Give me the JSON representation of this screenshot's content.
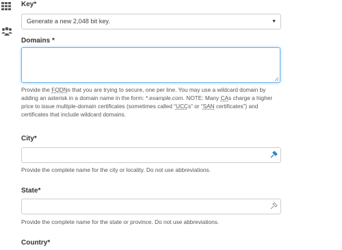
{
  "sidebar": {
    "icons": [
      "grid-icon",
      "users-icon"
    ],
    "accent": "#444444"
  },
  "form": {
    "key": {
      "label": "Key*",
      "selected": "Generate a new 2,048 bit key."
    },
    "domains": {
      "label": "Domains *",
      "value": "",
      "help": {
        "p1": "Provide the ",
        "abbr_fqdn": "FQDN",
        "p2": "s that you are trying to secure, one per line. You may use a wildcard domain by adding an asterisk in a domain name in the form: ",
        "example": "*.example.com",
        "p3": ". NOTE: Many ",
        "abbr_ca": "CA",
        "p4": "s charge a higher price to issue multiple-domain certificates (sometimes called “",
        "abbr_ucc": "UCC",
        "p5": "s” or “",
        "abbr_san": "SAN",
        "p6": " certificates”) and certificates that include wildcard domains."
      }
    },
    "city": {
      "label": "City*",
      "value": "",
      "help": "Provide the complete name for the city or locality. Do not use abbreviations."
    },
    "state": {
      "label": "State*",
      "value": "",
      "help": "Provide the complete name for the state or province. Do not use abbreviations."
    },
    "country": {
      "label": "Country*"
    }
  },
  "colors": {
    "focus_border": "#66afe9",
    "input_border": "#cccccc",
    "autofill_icon_city": "#2a87c8",
    "autofill_icon_state": "#999999"
  }
}
